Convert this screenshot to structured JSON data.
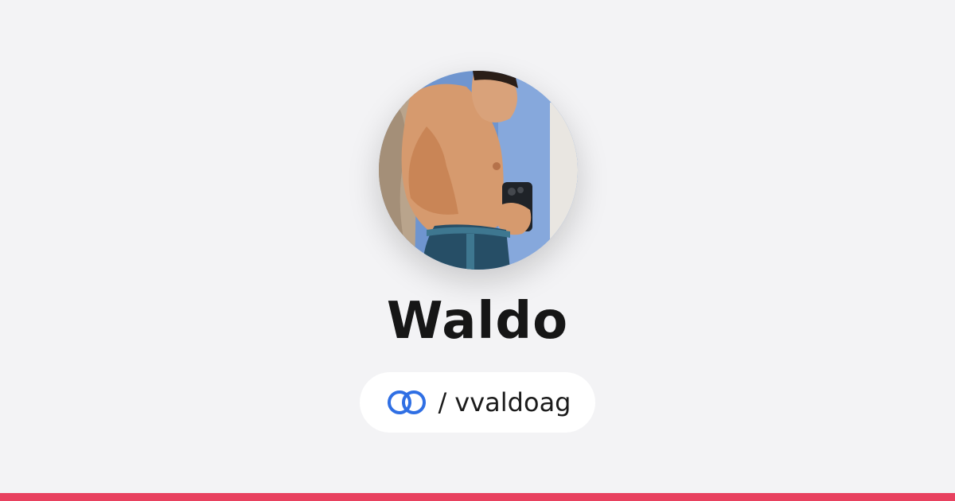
{
  "profile": {
    "display_name": "Waldo",
    "handle_separator": "/",
    "handle": "vvaldoag",
    "avatar_icon": "profile-photo",
    "brand_icon": "linked-rings-icon"
  },
  "colors": {
    "background": "#f3f3f5",
    "brand_blue": "#2f6fe4",
    "accent_bar": "#e8415f",
    "name_text": "#161616"
  }
}
